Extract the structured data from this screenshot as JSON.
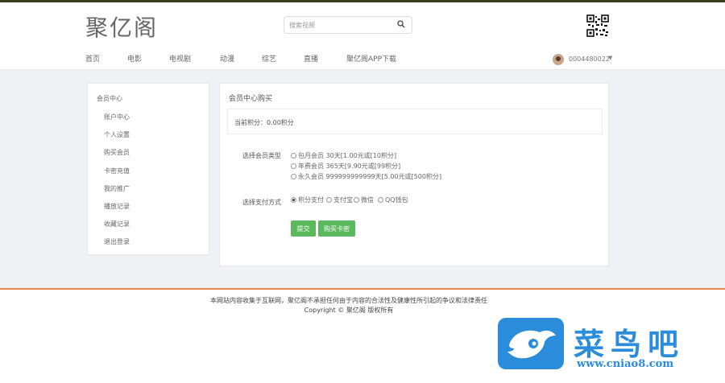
{
  "header": {
    "logo_text": "聚亿阁",
    "search": {
      "placeholder": "搜索视频"
    },
    "nav": [
      "首页",
      "电影",
      "电视剧",
      "动漫",
      "综艺",
      "直播",
      "聚亿阁APP下载"
    ],
    "user": {
      "name": "0004480022"
    }
  },
  "sidebar": {
    "title": "会员中心",
    "items": [
      "账户中心",
      "个人设置",
      "购买会员",
      "卡密充值",
      "我的推广",
      "播放记录",
      "收藏记录",
      "退出登录"
    ]
  },
  "main": {
    "panel_title": "会员中心购买",
    "current_points": "当前积分：0.00积分",
    "member_type_label": "选择会员类型",
    "member_options": [
      "包月会员 30天[1.00元或[10积分]",
      "年费会员 365天[9.90元或[99积分]",
      "永久会员 999999999999天[5.00元或[500积分]"
    ],
    "payment_label": "选择支付方式",
    "payment_options": [
      "积分支付",
      "支付宝",
      "微信",
      "QQ钱包"
    ],
    "buttons": {
      "submit": "提交",
      "buy": "购买卡密"
    }
  },
  "footer": {
    "disclaimer": "本网站内容收集于互联网，聚亿阁不承担任何由于内容的合法性及健康性所引起的争议和法律责任",
    "copyright": "Copyright © 聚亿阁 版权所有"
  },
  "watermark": {
    "text": "菜鸟吧",
    "url": "www.cniao8.com"
  },
  "colors": {
    "accent_green": "#5cb85c",
    "footer_border": "#e58a4a",
    "watermark_blue": "#2a8cdb"
  }
}
